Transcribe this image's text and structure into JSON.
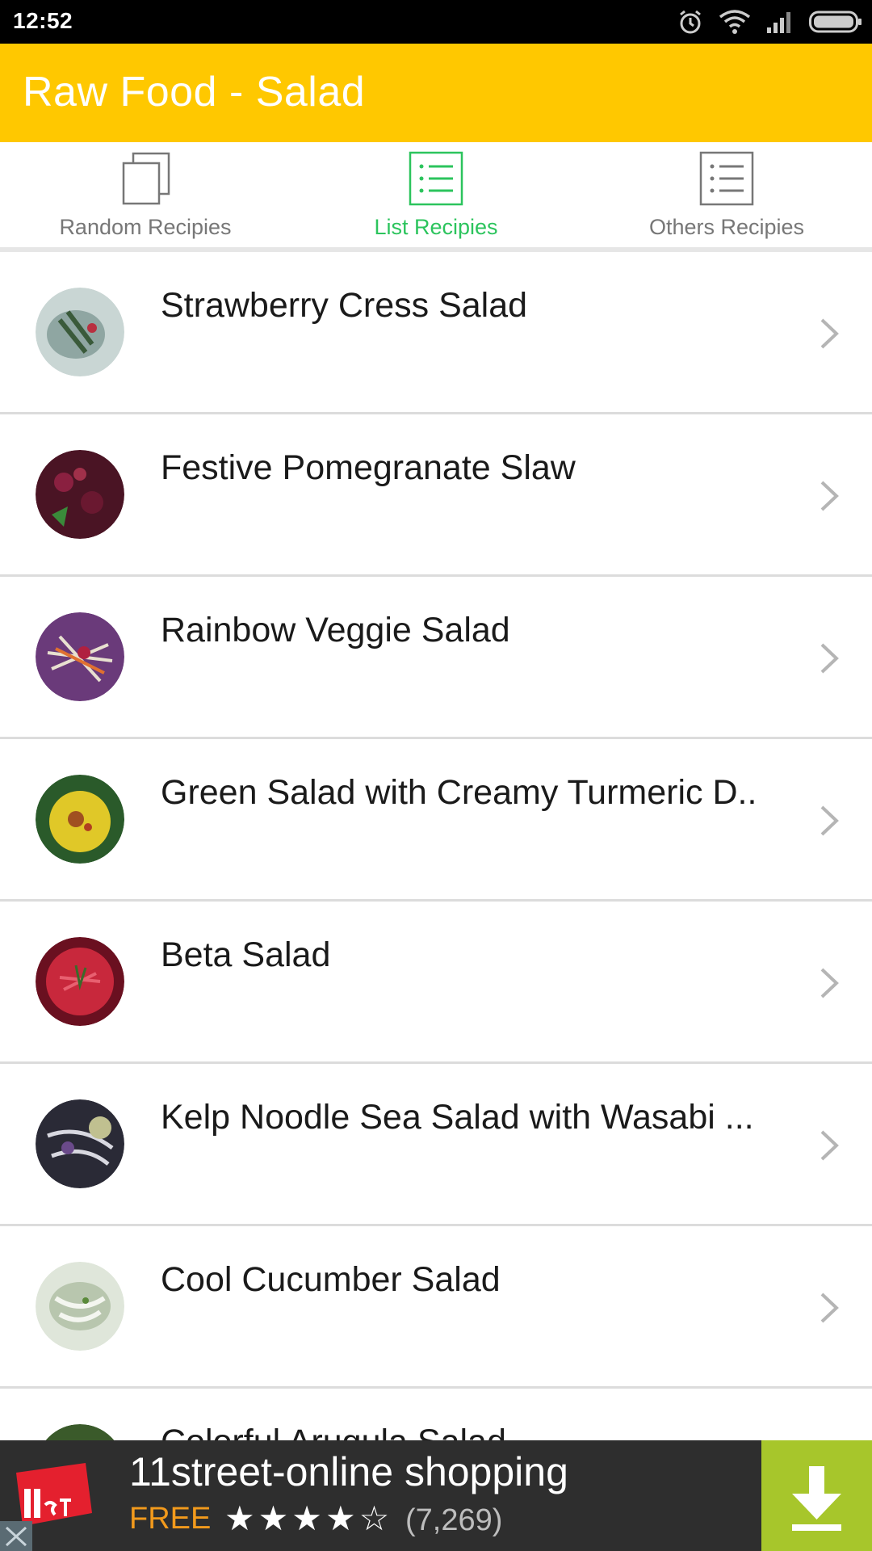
{
  "status_bar": {
    "time": "12:52",
    "icons": [
      "alarm-icon",
      "wifi-icon",
      "signal-icon",
      "battery-icon"
    ]
  },
  "app_bar": {
    "title": "Raw Food - Salad",
    "color": "#ffc800"
  },
  "tabs": [
    {
      "label": "Random Recipies",
      "icon": "random-squares-icon",
      "active": false
    },
    {
      "label": "List Recipies",
      "icon": "list-icon",
      "active": true
    },
    {
      "label": "Others Recipies",
      "icon": "list-icon",
      "active": false
    }
  ],
  "recipes": [
    {
      "title": "Strawberry Cress Salad",
      "thumb_color": "#9fb3b0"
    },
    {
      "title": "Festive Pomegranate Slaw",
      "thumb_color": "#5a1a2e"
    },
    {
      "title": "Rainbow Veggie Salad",
      "thumb_color": "#7a4a8a"
    },
    {
      "title": "Green Salad with Creamy Turmeric D..",
      "thumb_color": "#d8c22a"
    },
    {
      "title": "Beta Salad",
      "thumb_color": "#b8243a"
    },
    {
      "title": "Kelp Noodle Sea Salad with Wasabi ...",
      "thumb_color": "#3a3a4a"
    },
    {
      "title": "Cool Cucumber Salad",
      "thumb_color": "#c6cfc0"
    },
    {
      "title": "Colorful Arugula Salad",
      "thumb_color": "#4a6a3a"
    }
  ],
  "ad": {
    "title": "11street-online shopping",
    "price": "FREE",
    "stars": "★★★★☆",
    "rating_count": "(7,269)",
    "accent": "#a7c62b"
  }
}
